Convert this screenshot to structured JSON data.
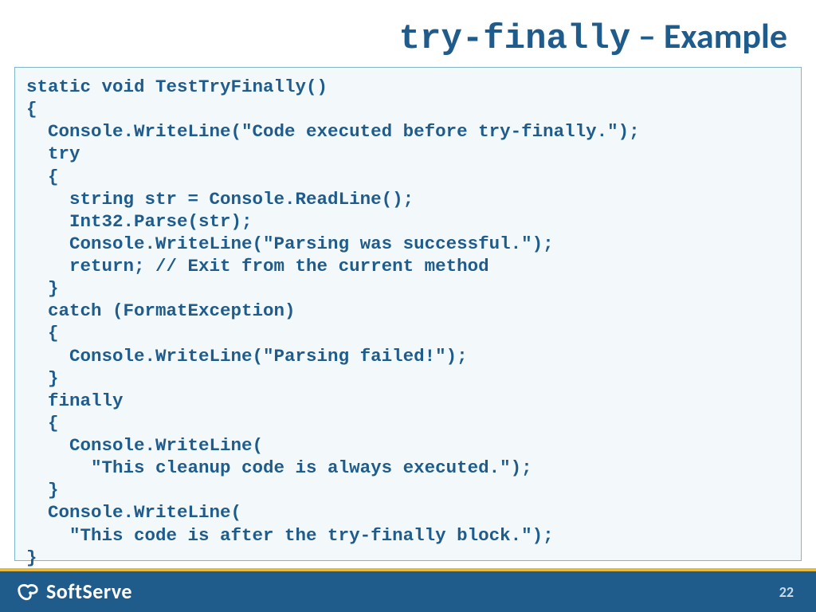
{
  "title": {
    "mono_part": "try-finally",
    "dash": " – ",
    "rest": "Example"
  },
  "code": "static void TestTryFinally()\n{\n  Console.WriteLine(\"Code executed before try-finally.\");\n  try\n  {\n    string str = Console.ReadLine();\n    Int32.Parse(str);\n    Console.WriteLine(\"Parsing was successful.\");\n    return; // Exit from the current method\n  }\n  catch (FormatException)\n  {\n    Console.WriteLine(\"Parsing failed!\");\n  }\n  finally\n  {\n    Console.WriteLine(\n      \"This cleanup code is always executed.\");\n  }\n  Console.WriteLine(\n    \"This code is after the try-finally block.\");\n}",
  "footer": {
    "brand": "SoftServe",
    "page": "22"
  }
}
